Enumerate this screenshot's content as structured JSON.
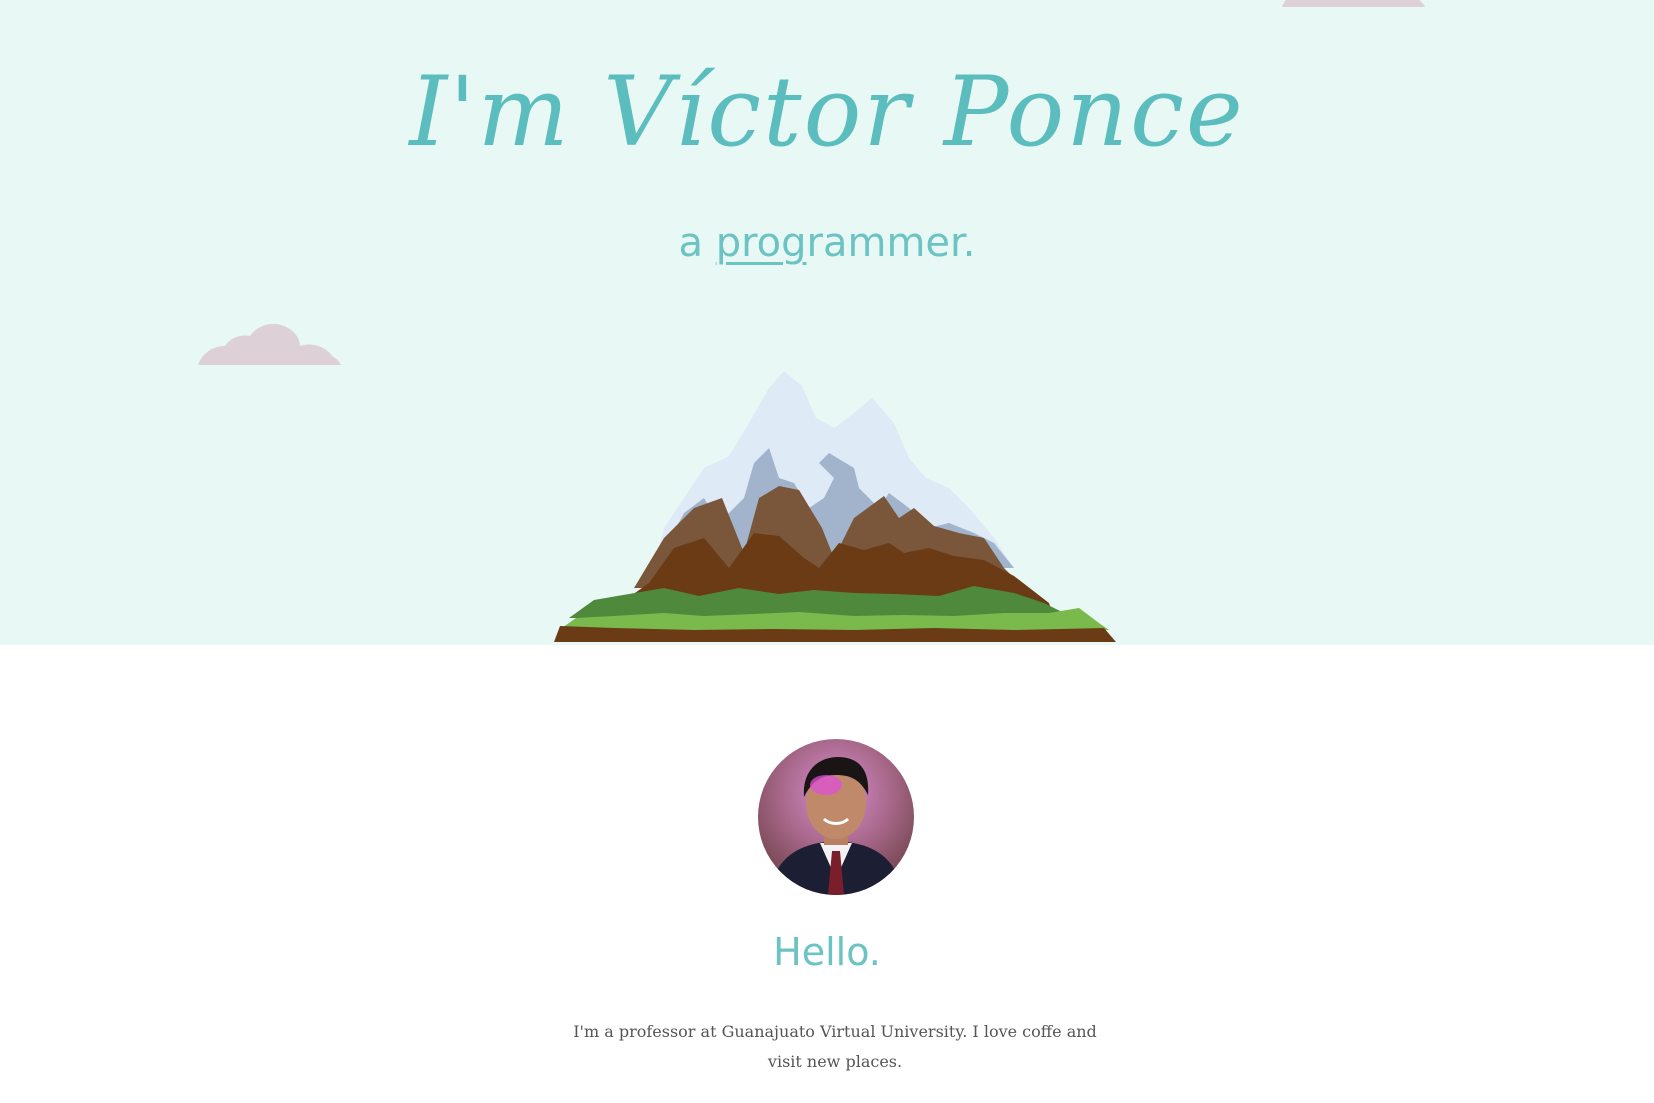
{
  "hero": {
    "title": "I'm Víctor Ponce",
    "subtitle_prefix": "a ",
    "subtitle_typed": "prog",
    "subtitle_rest": "rammer."
  },
  "about": {
    "heading": "Hello.",
    "bio": "I'm a professor at Guanajuato Virtual University. I love coffe and visit new places."
  },
  "colors": {
    "hero_background": "#e8f8f5",
    "accent": "#5bbdbd",
    "cloud": "#ddd0d7",
    "snow": "#dfeaf7",
    "rock_shadow": "#a1b4cc",
    "earth": "#7a573b",
    "earth_dark": "#6b3b16",
    "grass_dark": "#4f8a3c",
    "grass_light": "#7ab94c"
  },
  "icons": {
    "cloud_left": "cloud-icon",
    "cloud_top": "cloud-icon",
    "mountain": "mountain-illustration"
  }
}
